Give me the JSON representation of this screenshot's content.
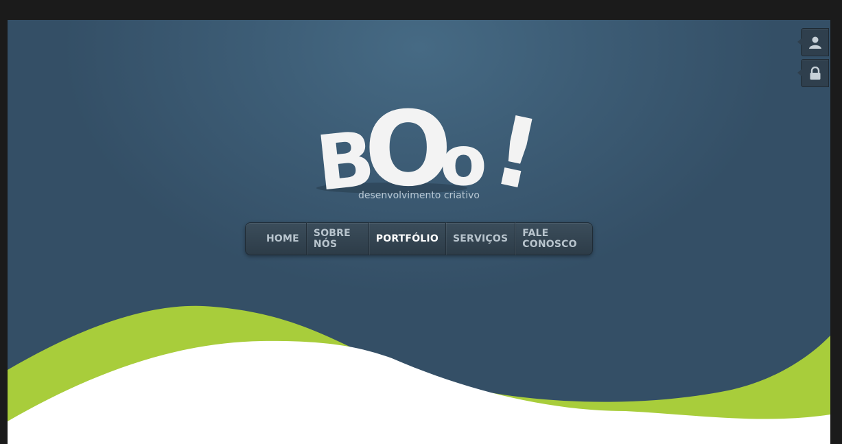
{
  "brand": {
    "logo_text": "BOo!",
    "tagline": "desenvolvimento criativo"
  },
  "nav": {
    "items": [
      {
        "label": "HOME",
        "active": false
      },
      {
        "label": "SOBRE NÓS",
        "active": false
      },
      {
        "label": "PORTFÓLIO",
        "active": true
      },
      {
        "label": "SERVIÇOS",
        "active": false
      },
      {
        "label": "FALE CONOSCO",
        "active": false
      }
    ]
  },
  "side_buttons": [
    {
      "icon": "user-icon"
    },
    {
      "icon": "lock-icon"
    }
  ],
  "colors": {
    "background_dark": "#1b1b1b",
    "header_blue": "#3d5d76",
    "accent_green": "#a8cd3b",
    "content_white": "#ffffff"
  }
}
